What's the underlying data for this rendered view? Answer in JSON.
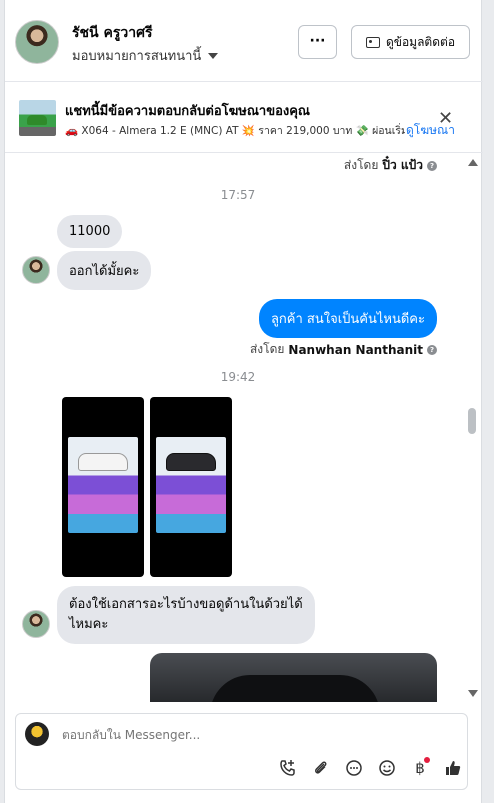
{
  "header": {
    "name": "รัชนี ครูวาศรี",
    "assign_label": "มอบหมายการสนทนานี้",
    "more_label": "···",
    "contact_label": "ดูข้อมูลติดต่อ"
  },
  "ad": {
    "title": "แชทนี้มีข้อความตอบกลับต่อโฆษณาของคุณ",
    "description": "🚗 X064 - Almera 1.2 E (MNC) AT 💥 ราคา 219,000 บาท 💸 ผ่อนเริ่มต้...",
    "view_ad_label": "ดูโฆษณา",
    "close_label": "✕"
  },
  "thread": {
    "top_sent_by_prefix": "ส่งโดย",
    "top_sent_by_name": "ปิ๋ว แป้ว",
    "time_1": "17:57",
    "msg_1": "11000",
    "msg_2": "ออกได้มั้ยคะ",
    "msg_out": "ลูกค้า สนใจเป็นคันไหนดีคะ",
    "out_sent_by_prefix": "ส่งโดย",
    "out_sent_by_name": "Nanwhan Nanthanit",
    "time_2": "19:42",
    "msg_3_line1": "ต้องใช้เอกสารอะไรบ้างขอดูด้านในด้วยได้",
    "msg_3_line2": "ไหมคะ"
  },
  "composer": {
    "placeholder": "ตอบกลับใน Messenger..."
  },
  "icons": [
    "more-icon",
    "id-card-icon",
    "close-icon",
    "info-icon",
    "call-plus-icon",
    "attach-icon",
    "chat-icon",
    "emoji-icon",
    "baht-icon",
    "thumbs-up-icon"
  ],
  "colors": {
    "outgoing_bubble": "#0084ff",
    "incoming_bubble": "#e4e6eb",
    "link": "#1877f2"
  }
}
